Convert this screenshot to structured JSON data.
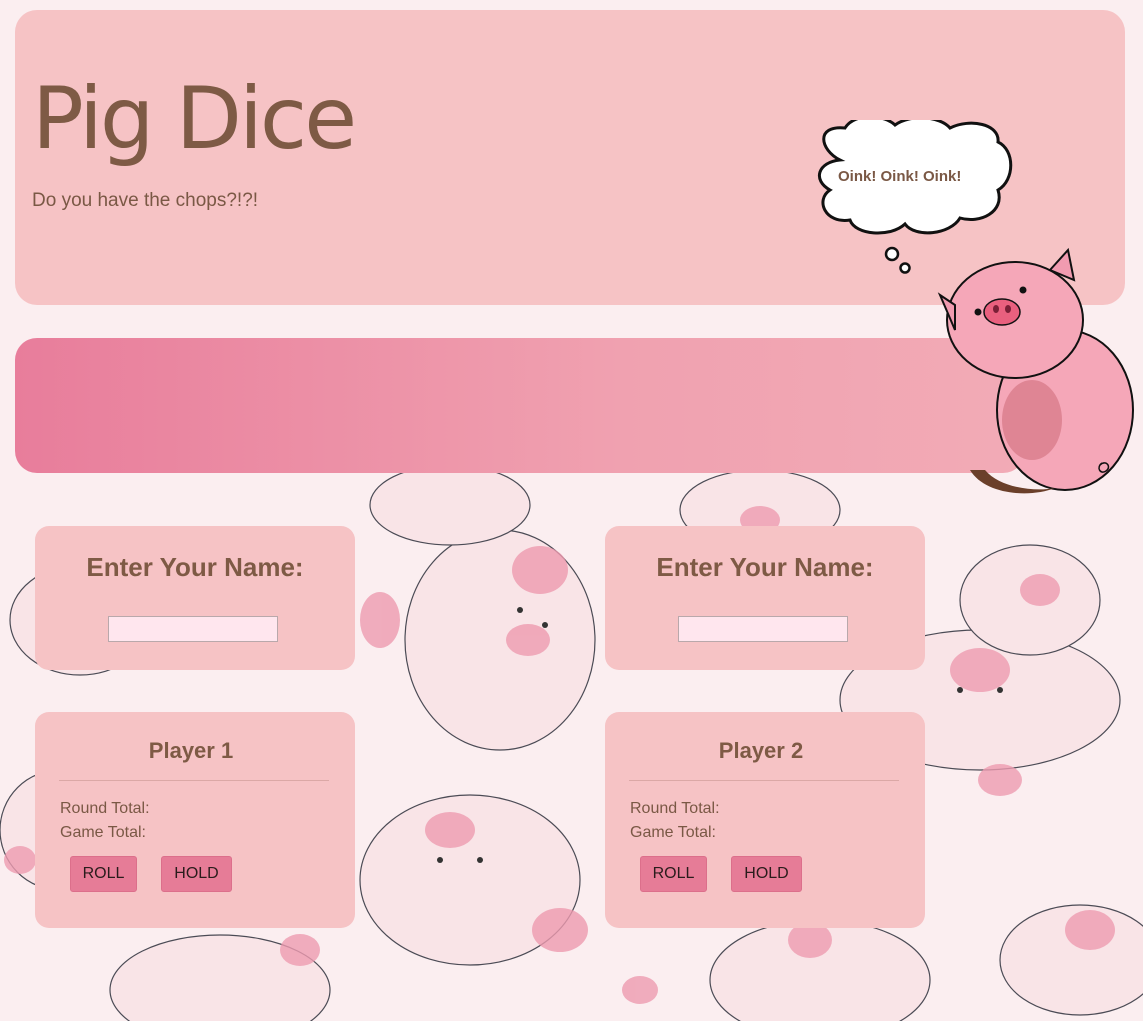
{
  "header": {
    "title": "Pig Dice",
    "tagline": "Do you have the chops?!?!",
    "speech": "Oink! Oink! Oink!"
  },
  "players": [
    {
      "name_prompt": "Enter Your Name:",
      "name_value": "",
      "label": "Player 1",
      "round_total_label": "Round Total:",
      "round_total": "",
      "game_total_label": "Game Total:",
      "game_total": "",
      "roll_label": "ROLL",
      "hold_label": "HOLD"
    },
    {
      "name_prompt": "Enter Your Name:",
      "name_value": "",
      "label": "Player 2",
      "round_total_label": "Round Total:",
      "round_total": "",
      "game_total_label": "Game Total:",
      "game_total": "",
      "roll_label": "ROLL",
      "hold_label": "HOLD"
    }
  ],
  "colors": {
    "panel": "#f6c3c5",
    "button": "#e67c97",
    "text": "#7e5a45",
    "band_start": "#e87d9b",
    "band_end": "#f2abb6"
  },
  "icons": [
    "pig-pattern-background",
    "thought-bubble-icon",
    "pig-mascot-icon"
  ]
}
